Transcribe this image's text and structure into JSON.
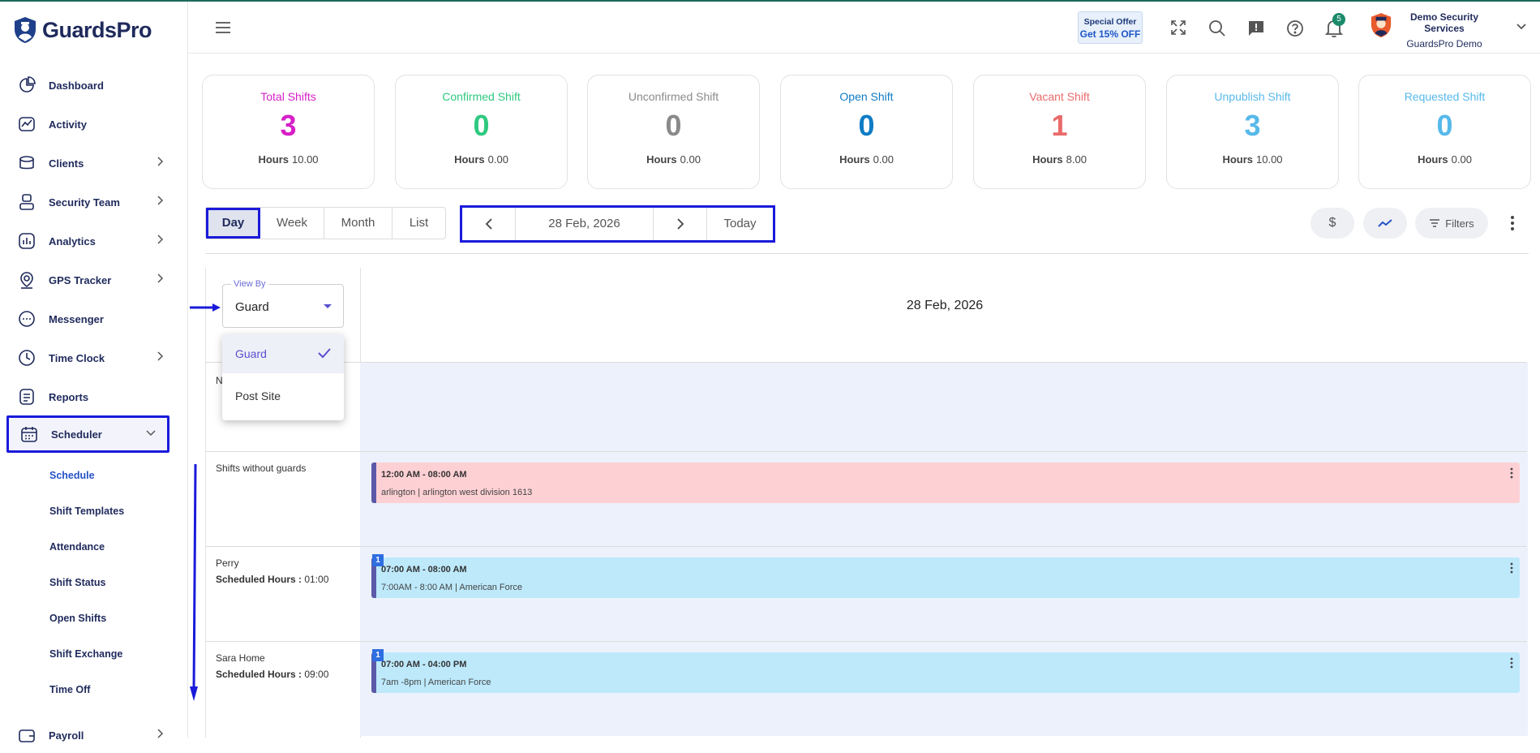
{
  "brand": {
    "name": "GuardsPro"
  },
  "sidebar": {
    "items": [
      {
        "label": "Dashboard",
        "icon": "dashboard-icon",
        "has_chevron": false
      },
      {
        "label": "Activity",
        "icon": "activity-icon",
        "has_chevron": false
      },
      {
        "label": "Clients",
        "icon": "clients-icon",
        "has_chevron": true
      },
      {
        "label": "Security Team",
        "icon": "security-team-icon",
        "has_chevron": true
      },
      {
        "label": "Analytics",
        "icon": "analytics-icon",
        "has_chevron": true
      },
      {
        "label": "GPS Tracker",
        "icon": "gps-icon",
        "has_chevron": true
      },
      {
        "label": "Messenger",
        "icon": "messenger-icon",
        "has_chevron": false
      },
      {
        "label": "Time Clock",
        "icon": "clock-icon",
        "has_chevron": true
      },
      {
        "label": "Reports",
        "icon": "reports-icon",
        "has_chevron": false
      },
      {
        "label": "Scheduler",
        "icon": "calendar-icon",
        "has_chevron": true,
        "expanded": true,
        "active": true
      },
      {
        "label": "Payroll",
        "icon": "payroll-icon",
        "has_chevron": true
      }
    ],
    "scheduler_sub": [
      "Schedule",
      "Shift Templates",
      "Attendance",
      "Shift Status",
      "Open Shifts",
      "Shift Exchange",
      "Time Off"
    ],
    "current_sub": "Schedule"
  },
  "header": {
    "offer_line1": "Special Offer",
    "offer_line2": "Get 15% OFF",
    "notification_count": "5",
    "company_name": "Demo Security Services",
    "user_name": "GuardsPro Demo"
  },
  "stats": [
    {
      "title": "Total Shifts",
      "value": "3",
      "hours_label": "Hours",
      "hours": "10.00",
      "color": "#d61fc7"
    },
    {
      "title": "Confirmed Shift",
      "value": "0",
      "hours_label": "Hours",
      "hours": "0.00",
      "color": "#2ec97f"
    },
    {
      "title": "Unconfirmed Shift",
      "value": "0",
      "hours_label": "Hours",
      "hours": "0.00",
      "color": "#8a8a8a"
    },
    {
      "title": "Open Shift",
      "value": "0",
      "hours_label": "Hours",
      "hours": "0.00",
      "color": "#0e7cc4"
    },
    {
      "title": "Vacant Shift",
      "value": "1",
      "hours_label": "Hours",
      "hours": "8.00",
      "color": "#ea6a6a"
    },
    {
      "title": "Unpublish Shift",
      "value": "3",
      "hours_label": "Hours",
      "hours": "10.00",
      "color": "#57b9ea"
    },
    {
      "title": "Requested Shift",
      "value": "0",
      "hours_label": "Hours",
      "hours": "0.00",
      "color": "#57b9ea"
    }
  ],
  "view_tabs": [
    "Day",
    "Week",
    "Month",
    "List"
  ],
  "selected_view": "Day",
  "date_nav": {
    "date": "28 Feb, 2026",
    "today": "Today"
  },
  "toolbar": {
    "filters": "Filters"
  },
  "view_by": {
    "label": "View By",
    "value": "Guard",
    "options": [
      "Guard",
      "Post Site"
    ]
  },
  "grid": {
    "day_header": "28 Feb, 2026",
    "partial_label": "N",
    "rows": [
      {
        "name": "Shifts without guards",
        "scheduled_label": "",
        "scheduled_hours": "",
        "shift_time": "12:00 AM - 08:00 AM",
        "shift_desc": "arlington | arlington west division 1613",
        "count": ""
      },
      {
        "name": "Perry",
        "scheduled_label": "Scheduled Hours :",
        "scheduled_hours": "01:00",
        "shift_time": "07:00 AM - 08:00 AM",
        "shift_desc": "7:00AM - 8:00 AM | American Force",
        "count": "1"
      },
      {
        "name": "Sara Home",
        "scheduled_label": "Scheduled Hours :",
        "scheduled_hours": "09:00",
        "shift_time": "07:00 AM - 04:00 PM",
        "shift_desc": "7am -8pm | American Force",
        "count": "1"
      }
    ]
  }
}
